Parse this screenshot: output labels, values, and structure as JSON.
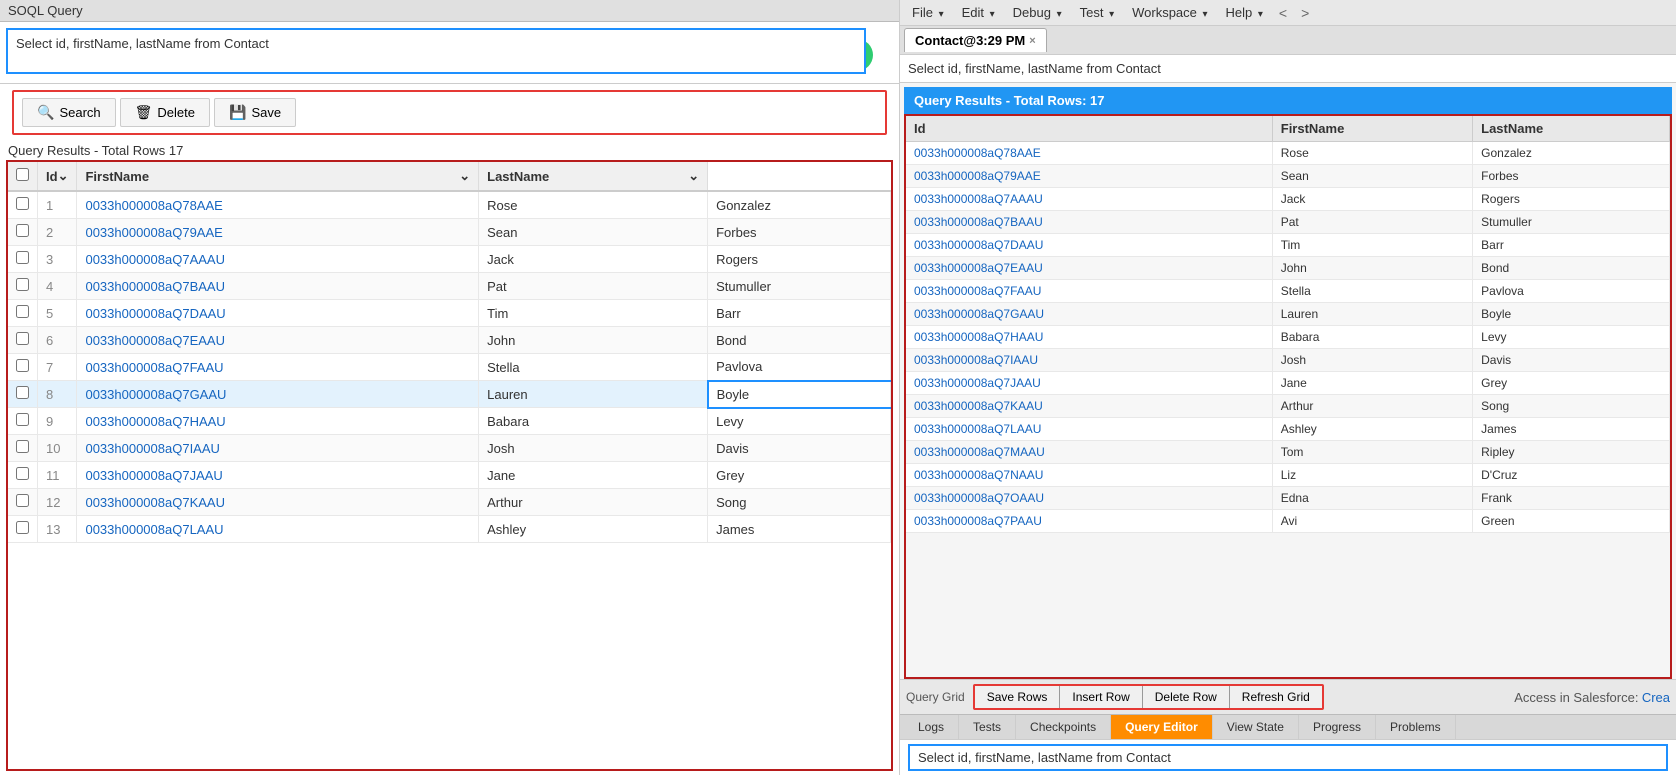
{
  "app": {
    "title": "SOQL Query"
  },
  "left": {
    "query_value": "Select id, firstName, lastName from Contact",
    "run_icon": "G",
    "toolbar": {
      "search_label": "Search",
      "delete_label": "Delete",
      "save_label": "Save"
    },
    "results_label": "Query Results - Total Rows 17",
    "columns": [
      "Id",
      "FirstName",
      "LastName"
    ],
    "rows": [
      {
        "num": 1,
        "id": "0033h000008aQ78AAE",
        "firstName": "Rose",
        "lastName": "Gonzalez"
      },
      {
        "num": 2,
        "id": "0033h000008aQ79AAE",
        "firstName": "Sean",
        "lastName": "Forbes"
      },
      {
        "num": 3,
        "id": "0033h000008aQ7AAAU",
        "firstName": "Jack",
        "lastName": "Rogers"
      },
      {
        "num": 4,
        "id": "0033h000008aQ7BAAU",
        "firstName": "Pat",
        "lastName": "Stumuller"
      },
      {
        "num": 5,
        "id": "0033h000008aQ7DAAU",
        "firstName": "Tim",
        "lastName": "Barr"
      },
      {
        "num": 6,
        "id": "0033h000008aQ7EAAU",
        "firstName": "John",
        "lastName": "Bond"
      },
      {
        "num": 7,
        "id": "0033h000008aQ7FAAU",
        "firstName": "Stella",
        "lastName": "Pavlova"
      },
      {
        "num": 8,
        "id": "0033h000008aQ7GAAU",
        "firstName": "Lauren",
        "lastName": "Boyle",
        "highlight": true
      },
      {
        "num": 9,
        "id": "0033h000008aQ7HAAU",
        "firstName": "Babara",
        "lastName": "Levy"
      },
      {
        "num": 10,
        "id": "0033h000008aQ7IAAU",
        "firstName": "Josh",
        "lastName": "Davis"
      },
      {
        "num": 11,
        "id": "0033h000008aQ7JAAU",
        "firstName": "Jane",
        "lastName": "Grey"
      },
      {
        "num": 12,
        "id": "0033h000008aQ7KAAU",
        "firstName": "Arthur",
        "lastName": "Song"
      },
      {
        "num": 13,
        "id": "0033h000008aQ7LAAU",
        "firstName": "Ashley",
        "lastName": "James"
      }
    ]
  },
  "right": {
    "menubar": {
      "items": [
        "File",
        "Edit",
        "Debug",
        "Test",
        "Workspace",
        "Help"
      ]
    },
    "tab": {
      "label": "Contact@3:29 PM",
      "close": "×"
    },
    "query_text": "Select id, firstName, lastName from Contact",
    "results_header": "Query Results - Total Rows: 17",
    "columns": [
      "Id",
      "FirstName",
      "LastName"
    ],
    "rows": [
      {
        "id": "0033h000008aQ78AAE",
        "firstName": "Rose",
        "lastName": "Gonzalez"
      },
      {
        "id": "0033h000008aQ79AAE",
        "firstName": "Sean",
        "lastName": "Forbes"
      },
      {
        "id": "0033h000008aQ7AAAU",
        "firstName": "Jack",
        "lastName": "Rogers"
      },
      {
        "id": "0033h000008aQ7BAAU",
        "firstName": "Pat",
        "lastName": "Stumuller"
      },
      {
        "id": "0033h000008aQ7DAAU",
        "firstName": "Tim",
        "lastName": "Barr"
      },
      {
        "id": "0033h000008aQ7EAAU",
        "firstName": "John",
        "lastName": "Bond"
      },
      {
        "id": "0033h000008aQ7FAAU",
        "firstName": "Stella",
        "lastName": "Pavlova"
      },
      {
        "id": "0033h000008aQ7GAAU",
        "firstName": "Lauren",
        "lastName": "Boyle"
      },
      {
        "id": "0033h000008aQ7HAAU",
        "firstName": "Babara",
        "lastName": "Levy"
      },
      {
        "id": "0033h000008aQ7IAAU",
        "firstName": "Josh",
        "lastName": "Davis"
      },
      {
        "id": "0033h000008aQ7JAAU",
        "firstName": "Jane",
        "lastName": "Grey"
      },
      {
        "id": "0033h000008aQ7KAAU",
        "firstName": "Arthur",
        "lastName": "Song"
      },
      {
        "id": "0033h000008aQ7LAAU",
        "firstName": "Ashley",
        "lastName": "James"
      },
      {
        "id": "0033h000008aQ7MAAU",
        "firstName": "Tom",
        "lastName": "Ripley"
      },
      {
        "id": "0033h000008aQ7NAAU",
        "firstName": "Liz",
        "lastName": "D'Cruz"
      },
      {
        "id": "0033h000008aQ7OAAU",
        "firstName": "Edna",
        "lastName": "Frank"
      },
      {
        "id": "0033h000008aQ7PAAU",
        "firstName": "Avi",
        "lastName": "Green"
      }
    ],
    "bottom_toolbar": {
      "query_grid_label": "Query Grid",
      "save_rows": "Save Rows",
      "insert_row": "Insert Row",
      "delete_row": "Delete Row",
      "refresh_grid": "Refresh Grid",
      "access_label": "Access in Salesforce:",
      "create_label": "Crea"
    },
    "bottom_tabs": {
      "tabs": [
        "Logs",
        "Tests",
        "Checkpoints",
        "Query Editor",
        "View State",
        "Progress",
        "Problems"
      ]
    },
    "bottom_query": "Select id, firstName, lastName from Contact"
  }
}
